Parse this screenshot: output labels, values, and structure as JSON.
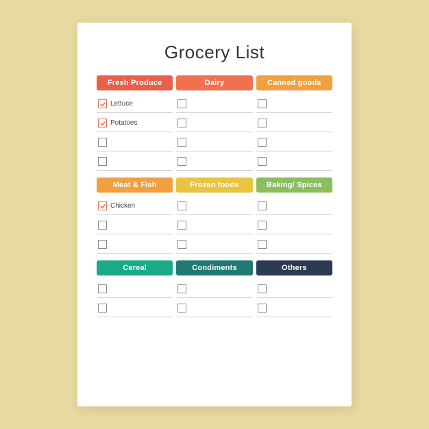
{
  "page": {
    "title": "Grocery List",
    "background": "#e8d9a0"
  },
  "sections": [
    {
      "id": "section1",
      "headers": [
        {
          "label": "Fresh Produce",
          "colorClass": "color-red"
        },
        {
          "label": "Dairy",
          "colorClass": "color-salmon"
        },
        {
          "label": "Canned goods",
          "colorClass": "color-orange"
        }
      ],
      "rows": [
        [
          {
            "checked": true,
            "label": "Lettuce"
          },
          {
            "checked": false,
            "label": ""
          },
          {
            "checked": false,
            "label": ""
          }
        ],
        [
          {
            "checked": true,
            "label": "Potatoes"
          },
          {
            "checked": false,
            "label": ""
          },
          {
            "checked": false,
            "label": ""
          }
        ],
        [
          {
            "checked": false,
            "label": ""
          },
          {
            "checked": false,
            "label": ""
          },
          {
            "checked": false,
            "label": ""
          }
        ],
        [
          {
            "checked": false,
            "label": ""
          },
          {
            "checked": false,
            "label": ""
          },
          {
            "checked": false,
            "label": ""
          }
        ]
      ]
    },
    {
      "id": "section2",
      "headers": [
        {
          "label": "Meat & Fish",
          "colorClass": "color-orange"
        },
        {
          "label": "Frozen foods",
          "colorClass": "color-yellow"
        },
        {
          "label": "Baking/ Spices",
          "colorClass": "color-green-light"
        }
      ],
      "rows": [
        [
          {
            "checked": true,
            "label": "Chicken"
          },
          {
            "checked": false,
            "label": ""
          },
          {
            "checked": false,
            "label": ""
          }
        ],
        [
          {
            "checked": false,
            "label": ""
          },
          {
            "checked": false,
            "label": ""
          },
          {
            "checked": false,
            "label": ""
          }
        ],
        [
          {
            "checked": false,
            "label": ""
          },
          {
            "checked": false,
            "label": ""
          },
          {
            "checked": false,
            "label": ""
          }
        ]
      ]
    },
    {
      "id": "section3",
      "headers": [
        {
          "label": "Cereal",
          "colorClass": "color-teal"
        },
        {
          "label": "Condiments",
          "colorClass": "color-dark-teal"
        },
        {
          "label": "Others",
          "colorClass": "color-dark-navy"
        }
      ],
      "rows": [
        [
          {
            "checked": false,
            "label": ""
          },
          {
            "checked": false,
            "label": ""
          },
          {
            "checked": false,
            "label": ""
          }
        ],
        [
          {
            "checked": false,
            "label": ""
          },
          {
            "checked": false,
            "label": ""
          },
          {
            "checked": false,
            "label": ""
          }
        ]
      ]
    }
  ]
}
